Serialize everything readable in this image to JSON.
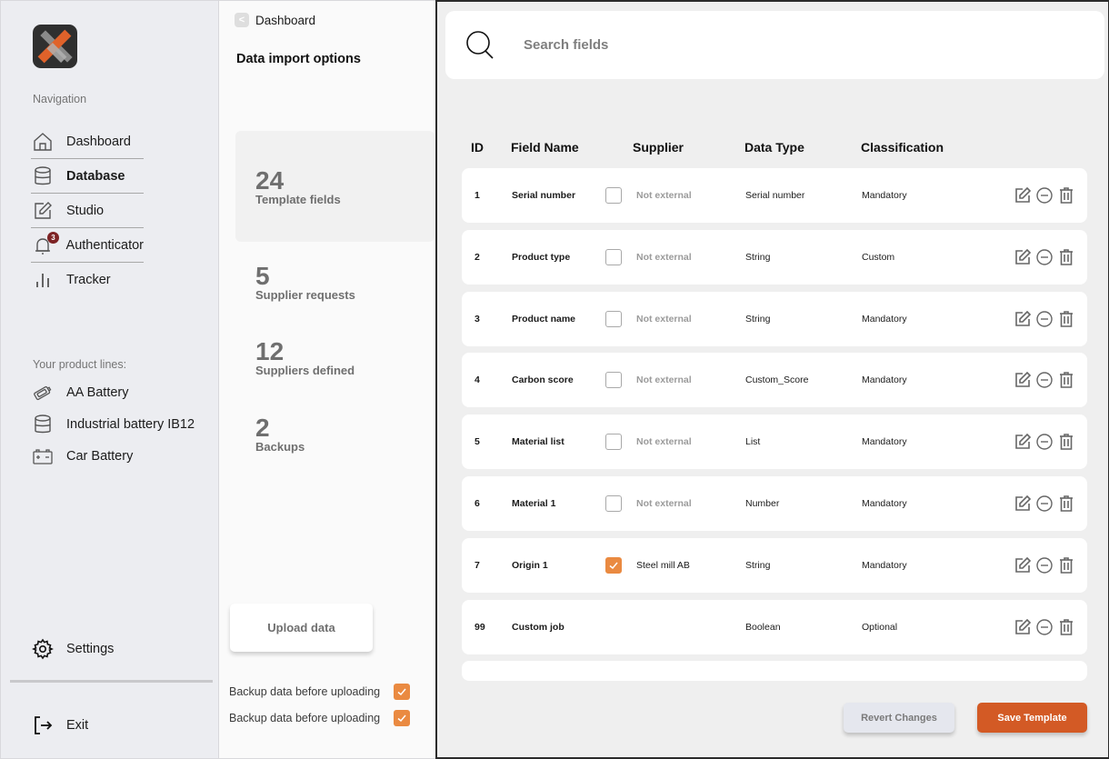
{
  "sidebar": {
    "logo": "app-logo",
    "nav_heading": "Navigation",
    "nav_items": [
      {
        "label": "Dashboard",
        "icon": "home-icon",
        "active": false
      },
      {
        "label": "Database",
        "icon": "database-icon",
        "active": true
      },
      {
        "label": "Studio",
        "icon": "edit-icon",
        "active": false
      },
      {
        "label": "Authenticator",
        "icon": "bell-icon",
        "active": false,
        "badge": "3"
      },
      {
        "label": "Tracker",
        "icon": "bar-chart-icon",
        "active": false
      }
    ],
    "product_lines_heading": "Your product lines:",
    "product_lines": [
      {
        "label": "AA Battery",
        "icon": "aa-battery-icon"
      },
      {
        "label": "Industrial battery IB12",
        "icon": "database-icon"
      },
      {
        "label": "Car Battery",
        "icon": "car-battery-icon"
      }
    ],
    "settings_label": "Settings",
    "exit_label": "Exit"
  },
  "middle": {
    "back_label": "Dashboard",
    "title": "Data import options",
    "stats": [
      {
        "value": "24",
        "label": "Template fields"
      },
      {
        "value": "5",
        "label": "Supplier requests"
      },
      {
        "value": "12",
        "label": "Suppliers defined"
      },
      {
        "value": "2",
        "label": "Backups"
      }
    ],
    "upload_label": "Upload data",
    "options": [
      {
        "label": "Backup data before uploading",
        "checked": true
      },
      {
        "label": "Backup data before uploading",
        "checked": true
      }
    ]
  },
  "main": {
    "search_placeholder": "Search fields",
    "columns": [
      "ID",
      "Field Name",
      "Supplier",
      "Data Type",
      "Classification"
    ],
    "rows": [
      {
        "id": "1",
        "name": "Serial number",
        "external": false,
        "supplier": "Not external",
        "type": "Serial number",
        "classification": "Mandatory"
      },
      {
        "id": "2",
        "name": "Product type",
        "external": false,
        "supplier": "Not external",
        "type": "String",
        "classification": "Custom"
      },
      {
        "id": "3",
        "name": "Product name",
        "external": false,
        "supplier": "Not external",
        "type": "String",
        "classification": "Mandatory"
      },
      {
        "id": "4",
        "name": "Carbon score",
        "external": false,
        "supplier": "Not external",
        "type": "Custom_Score",
        "classification": "Mandatory"
      },
      {
        "id": "5",
        "name": "Material list",
        "external": false,
        "supplier": "Not external",
        "type": "List",
        "classification": "Mandatory"
      },
      {
        "id": "6",
        "name": "Material 1",
        "external": false,
        "supplier": "Not external",
        "type": "Number",
        "classification": "Mandatory"
      },
      {
        "id": "7",
        "name": "Origin 1",
        "external": true,
        "supplier": "Steel mill AB",
        "type": "String",
        "classification": "Mandatory"
      },
      {
        "id": "99",
        "name": "Custom job",
        "external": null,
        "supplier": "",
        "type": "Boolean",
        "classification": "Optional"
      }
    ],
    "revert_label": "Revert Changes",
    "save_label": "Save Template"
  },
  "colors": {
    "accent": "#d35a25",
    "checkbox": "#ea8a41",
    "badge": "#7d2325"
  }
}
